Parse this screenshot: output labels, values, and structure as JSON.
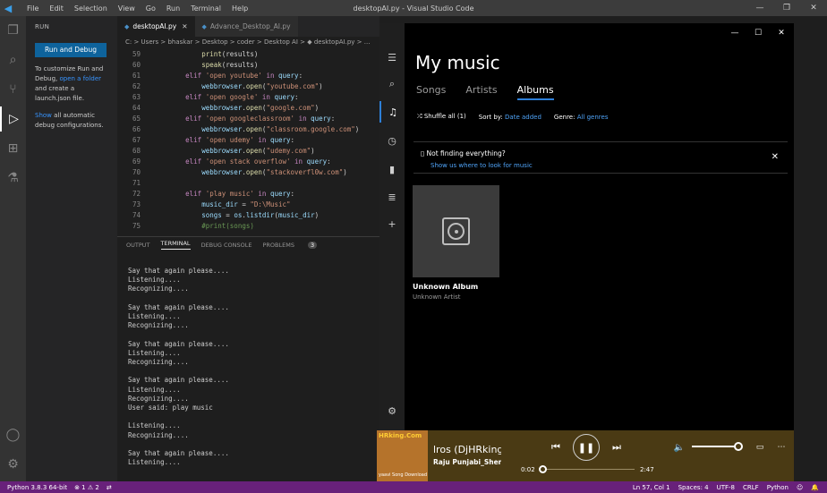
{
  "vscode": {
    "window_title": "desktopAI.py - Visual Studio Code",
    "menu": [
      "File",
      "Edit",
      "Selection",
      "View",
      "Go",
      "Run",
      "Terminal",
      "Help"
    ],
    "sidebar": {
      "header": "RUN",
      "run_button": "Run and Debug",
      "text1a": "To customize Run and Debug, ",
      "text1_link": "open a folder",
      "text1b": " and create a launch.json file.",
      "text2_link": "Show",
      "text2b": " all automatic debug configurations."
    },
    "tabs": [
      {
        "label": "desktopAI.py",
        "active": true
      },
      {
        "label": "Advance_Desktop_AI.py",
        "active": false
      }
    ],
    "breadcrumb": "C: > Users > bhaskar > Desktop > coder > Desktop AI > ◆ desktopAI.py > ...",
    "code_lines": [
      {
        "n": "59",
        "parts": [
          [
            "op",
            "            "
          ],
          [
            "fn",
            "print"
          ],
          [
            "op",
            "(results)"
          ]
        ]
      },
      {
        "n": "60",
        "parts": [
          [
            "op",
            "            "
          ],
          [
            "fn",
            "speak"
          ],
          [
            "op",
            "(results)"
          ]
        ]
      },
      {
        "n": "61",
        "parts": [
          [
            "op",
            "        "
          ],
          [
            "kw",
            "elif"
          ],
          [
            "op",
            " "
          ],
          [
            "str",
            "'open youtube'"
          ],
          [
            "op",
            " "
          ],
          [
            "kw",
            "in"
          ],
          [
            "op",
            " "
          ],
          [
            "var",
            "query"
          ],
          [
            "op",
            ":"
          ]
        ]
      },
      {
        "n": "62",
        "parts": [
          [
            "op",
            "            "
          ],
          [
            "var",
            "webbrowser"
          ],
          [
            "op",
            "."
          ],
          [
            "fn",
            "open"
          ],
          [
            "op",
            "("
          ],
          [
            "str",
            "\"youtube.com\""
          ],
          [
            "op",
            ")"
          ]
        ]
      },
      {
        "n": "63",
        "parts": [
          [
            "op",
            "        "
          ],
          [
            "kw",
            "elif"
          ],
          [
            "op",
            " "
          ],
          [
            "str",
            "'open google'"
          ],
          [
            "op",
            " "
          ],
          [
            "kw",
            "in"
          ],
          [
            "op",
            " "
          ],
          [
            "var",
            "query"
          ],
          [
            "op",
            ":"
          ]
        ]
      },
      {
        "n": "64",
        "parts": [
          [
            "op",
            "            "
          ],
          [
            "var",
            "webbrowser"
          ],
          [
            "op",
            "."
          ],
          [
            "fn",
            "open"
          ],
          [
            "op",
            "("
          ],
          [
            "str",
            "\"google.com\""
          ],
          [
            "op",
            ")"
          ]
        ]
      },
      {
        "n": "65",
        "parts": [
          [
            "op",
            "        "
          ],
          [
            "kw",
            "elif"
          ],
          [
            "op",
            " "
          ],
          [
            "str",
            "'open googleclassroom'"
          ],
          [
            "op",
            " "
          ],
          [
            "kw",
            "in"
          ],
          [
            "op",
            " "
          ],
          [
            "var",
            "query"
          ],
          [
            "op",
            ":"
          ]
        ]
      },
      {
        "n": "66",
        "parts": [
          [
            "op",
            "            "
          ],
          [
            "var",
            "webbrowser"
          ],
          [
            "op",
            "."
          ],
          [
            "fn",
            "open"
          ],
          [
            "op",
            "("
          ],
          [
            "str",
            "\"classroom.google.com\""
          ],
          [
            "op",
            ")"
          ]
        ]
      },
      {
        "n": "67",
        "parts": [
          [
            "op",
            "        "
          ],
          [
            "kw",
            "elif"
          ],
          [
            "op",
            " "
          ],
          [
            "str",
            "'open udemy'"
          ],
          [
            "op",
            " "
          ],
          [
            "kw",
            "in"
          ],
          [
            "op",
            " "
          ],
          [
            "var",
            "query"
          ],
          [
            "op",
            ":"
          ]
        ]
      },
      {
        "n": "68",
        "parts": [
          [
            "op",
            "            "
          ],
          [
            "var",
            "webbrowser"
          ],
          [
            "op",
            "."
          ],
          [
            "fn",
            "open"
          ],
          [
            "op",
            "("
          ],
          [
            "str",
            "\"udemy.com\""
          ],
          [
            "op",
            ")"
          ]
        ]
      },
      {
        "n": "69",
        "parts": [
          [
            "op",
            "        "
          ],
          [
            "kw",
            "elif"
          ],
          [
            "op",
            " "
          ],
          [
            "str",
            "'open stack overflow'"
          ],
          [
            "op",
            " "
          ],
          [
            "kw",
            "in"
          ],
          [
            "op",
            " "
          ],
          [
            "var",
            "query"
          ],
          [
            "op",
            ":"
          ]
        ]
      },
      {
        "n": "70",
        "parts": [
          [
            "op",
            "            "
          ],
          [
            "var",
            "webbrowser"
          ],
          [
            "op",
            "."
          ],
          [
            "fn",
            "open"
          ],
          [
            "op",
            "("
          ],
          [
            "str",
            "\"stackoverfl0w.com\""
          ],
          [
            "op",
            ")"
          ]
        ]
      },
      {
        "n": "71",
        "parts": [
          [
            "op",
            ""
          ]
        ]
      },
      {
        "n": "72",
        "parts": [
          [
            "op",
            "        "
          ],
          [
            "kw",
            "elif"
          ],
          [
            "op",
            " "
          ],
          [
            "str",
            "'play music'"
          ],
          [
            "op",
            " "
          ],
          [
            "kw",
            "in"
          ],
          [
            "op",
            " "
          ],
          [
            "var",
            "query"
          ],
          [
            "op",
            ":"
          ]
        ]
      },
      {
        "n": "73",
        "parts": [
          [
            "op",
            "            "
          ],
          [
            "var",
            "music_dir"
          ],
          [
            "op",
            " = "
          ],
          [
            "str",
            "\"D:\\Music\""
          ]
        ]
      },
      {
        "n": "74",
        "parts": [
          [
            "op",
            "            "
          ],
          [
            "var",
            "songs"
          ],
          [
            "op",
            " = "
          ],
          [
            "var",
            "os"
          ],
          [
            "op",
            "."
          ],
          [
            "var",
            "listdir"
          ],
          [
            "op",
            "("
          ],
          [
            "var",
            "music_dir"
          ],
          [
            "op",
            ")"
          ]
        ]
      },
      {
        "n": "75",
        "parts": [
          [
            "op",
            "            "
          ],
          [
            "cmt",
            "#print(songs)"
          ]
        ]
      }
    ],
    "panel_tabs": [
      "OUTPUT",
      "TERMINAL",
      "DEBUG CONSOLE",
      "PROBLEMS"
    ],
    "panel_active": "TERMINAL",
    "problems_count": "3",
    "terminal_lines": [
      "Say that again please....",
      "Listening....",
      "Recognizing....",
      "",
      "Say that again please....",
      "Listening....",
      "Recognizing....",
      "",
      "Say that again please....",
      "Listening....",
      "Recognizing....",
      "",
      "Say that again please....",
      "Listening....",
      "Recognizing....",
      "User said: play music",
      "",
      "Listening....",
      "Recognizing....",
      "",
      "Say that again please....",
      "Listening...."
    ],
    "status_left": [
      "Python 3.8.3 64-bit",
      "⊗ 1 ⚠ 2"
    ],
    "status_right": [
      "Ln 57, Col 1",
      "Spaces: 4",
      "UTF-8",
      "CRLF",
      "Python"
    ]
  },
  "music_app": {
    "title": "My music",
    "tabs": [
      "Songs",
      "Artists",
      "Albums"
    ],
    "active_tab": "Albums",
    "shuffle_label": "Shuffle all (1)",
    "sort_label": "Sort by:",
    "sort_value": "Date added",
    "genre_label": "Genre:",
    "genre_value": "All genres",
    "notice_title": "Not finding everything?",
    "notice_link": "Show us where to look for music",
    "album_name": "Unknown Album",
    "album_artist": "Unknown Artist",
    "player": {
      "cover_text": "HRking.Com",
      "cover_caption": "yaavi Song Download",
      "song_title": "lros (DjHRking.C",
      "song_artist": "Raju Punjabi_Sher",
      "time_current": "0:02",
      "time_total": "2:47",
      "progress_fraction": 0.012,
      "volume_fraction": 1.0
    }
  }
}
